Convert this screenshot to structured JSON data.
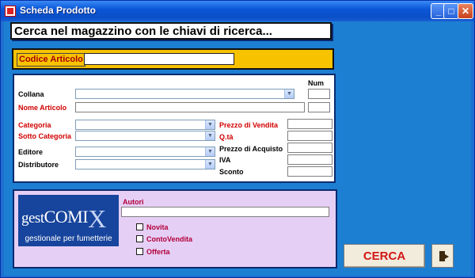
{
  "window": {
    "title": "Scheda Prodotto",
    "minimize_glyph": "_",
    "maximize_glyph": "□",
    "close_glyph": "✕"
  },
  "search_header": "Cerca nel magazzino con le chiavi di ricerca...",
  "code": {
    "label": "Codice Articolo",
    "value": ""
  },
  "form": {
    "num_label": "Num",
    "collana_label": "Collana",
    "nome_label": "Nome Articolo",
    "categoria_label": "Categoria",
    "sotto_categoria_label": "Sotto Categoria",
    "editore_label": "Editore",
    "distributore_label": "Distributore",
    "prezzo_vendita_label": "Prezzo di Vendita",
    "qta_label": "Q.tà",
    "prezzo_acquisto_label": "Prezzo di Acquisto",
    "iva_label": "IVA",
    "sconto_label": "Sconto"
  },
  "lower": {
    "autori_label": "Autori",
    "novita_label": "Novita",
    "contovendita_label": "ContoVendita",
    "offerta_label": "Offerta"
  },
  "logo": {
    "word_gest": "gest",
    "word_comi": "COMI",
    "word_x": "X",
    "subtitle": "gestionale per fumetterie"
  },
  "buttons": {
    "cerca": "CERCA"
  },
  "colors": {
    "titlebar": "#0b57d8",
    "client_bg": "#1d7fd2",
    "code_panel": "#f7c200",
    "lower_panel": "#e6cff5",
    "red_label": "#d10000",
    "logo_bg": "#17449c"
  }
}
